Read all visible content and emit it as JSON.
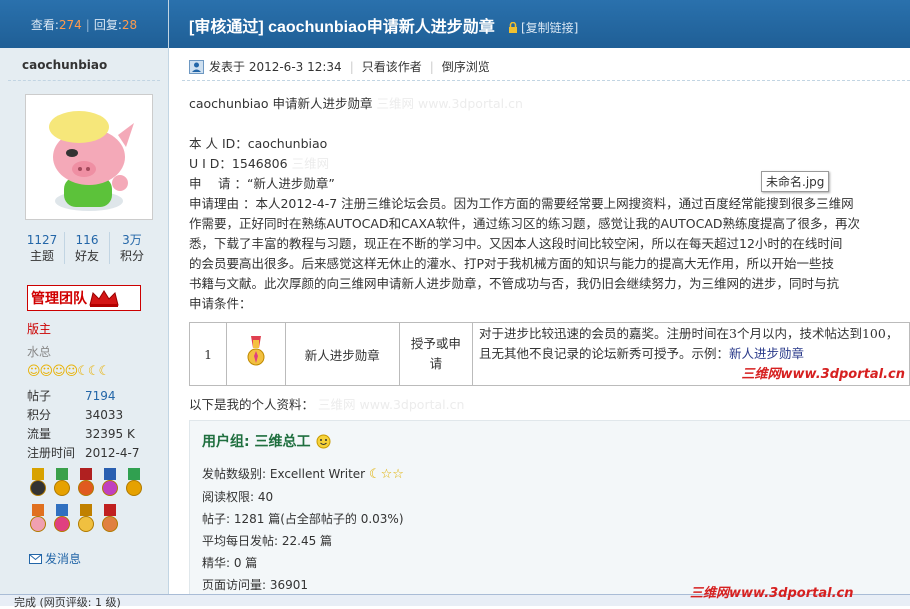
{
  "stats": {
    "views_label": "查看:",
    "views": "274",
    "replies_label": "回复:",
    "replies": "28"
  },
  "thread": {
    "title": "[审核通过] caochunbiao申请新人进步勋章",
    "copy_link": "[复制链接]"
  },
  "author": {
    "name": "caochunbiao",
    "counts": [
      {
        "value": "1127",
        "label": "主题"
      },
      {
        "value": "116",
        "label": "好友"
      },
      {
        "value": "3万",
        "label": "积分"
      }
    ],
    "admin_badge": "管理团队",
    "role1": "版主",
    "role2": "水总",
    "info": [
      {
        "k": "帖子",
        "v": "7194"
      },
      {
        "k": "积分",
        "v": "34033"
      },
      {
        "k": "流量",
        "v": "32395 K"
      },
      {
        "k": "注册时间",
        "v": "2012-4-7"
      }
    ],
    "message_link": "发消息"
  },
  "meta": {
    "posted": "发表于 2012-6-3 12:34",
    "only_author": "只看该作者",
    "reverse": "倒序浏览"
  },
  "post": {
    "heading": "caochunbiao 申请新人进步勋章",
    "heading_wm": "三维网 www.3dportal.cn",
    "id_line": "本 人 ID：caochunbiao",
    "uid_line": "U  I  D：1546806",
    "uid_wm": "三维网",
    "apply_line": "申　 请 ：“新人进步勋章”",
    "reason": [
      "申请理由 ：本人2012-4-7 注册三维论坛会员。因为工作方面的需要经常要上网搜资料，通过百度经常能搜到很多三维网",
      "作需要，正好同时在熟练AUTOCAD和CAXA软件，通过练习区的练习题，感觉让我的AUTOCAD熟练度提高了很多，再次",
      "悉，下载了丰富的教程与习题，现正在不断的学习中。又因本人这段时间比较空闲，所以在每天超过12小时的在线时间",
      "的会员要高出很多。后来感觉这样无休止的灌水、打P对于我机械方面的知识与能力的提高大无作用，所以开始一些技",
      "书籍与文献。此次厚颜的向三维网申请新人进步勋章，不管成功与否，我仍旧会继续努力，为三维网的进步，同时与抗"
    ],
    "conditions_label": "申请条件：",
    "image_tooltip": "未命名.jpg",
    "table": {
      "num": "1",
      "medal_name": "新人进步勋章",
      "method": "授予或申请",
      "desc": "对于进步比较迅速的会员的嘉奖。注册时间在3个月以内，技术帖达到100，且无其他不良记录的论坛新秀可授予。示例：",
      "example": "新人进步勋章",
      "site_wm": "三维网www.3dportal.cn"
    },
    "after": "以下是我的个人资料：",
    "after_wm": "三维网 www.3dportal.cn"
  },
  "profile": {
    "group": "用户组: 三维总工",
    "level_label": "发帖数级别: Excellent Writer",
    "read_perm": "阅读权限: 40",
    "posts": "帖子: 1281 篇(占全部帖子的  0.03%)",
    "avg": "平均每日发帖: 22.45 篇",
    "digest": "精华: 0 篇",
    "pageviews": "页面访问量: 36901"
  },
  "status": {
    "text": "完成 (网页评级: 1 级)"
  },
  "footer_wm": "三维网www.3dportal.cn",
  "colors": {
    "header_blue": "#2a71ad",
    "link": "#2366a8",
    "accent_orange": "#ff9b4d",
    "admin_red": "#d00000",
    "group_green": "#1f6f3f"
  }
}
